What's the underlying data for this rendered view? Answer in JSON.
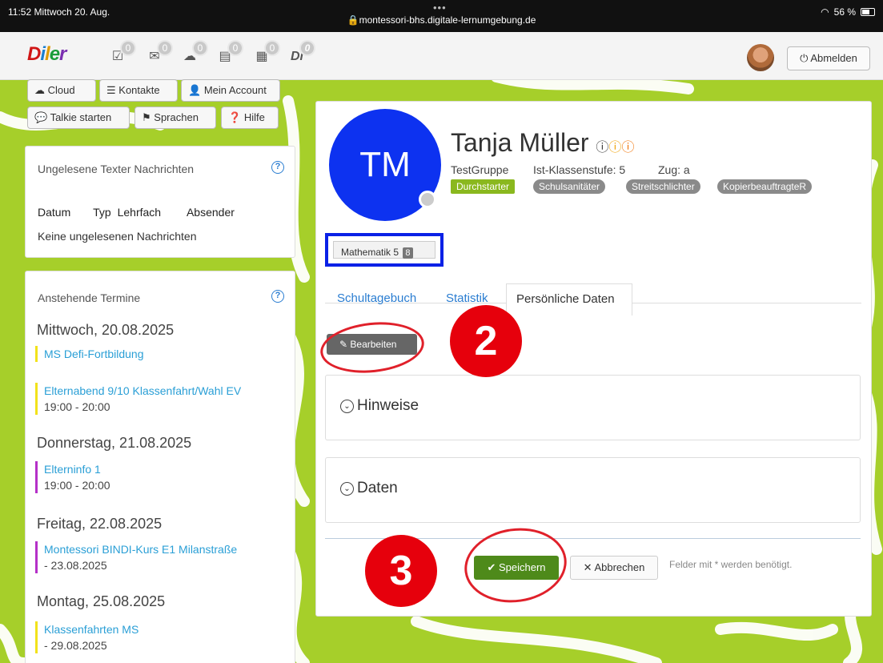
{
  "status_bar": {
    "time": "11:52",
    "date": "Mittwoch 20. Aug.",
    "dots": "•••",
    "url": "montessori-bhs.digitale-lernumgebung.de",
    "battery": "56 %"
  },
  "topbar": {
    "logo": {
      "d": "D",
      "i": "i",
      "l": "l",
      "e": "e",
      "r": "r"
    },
    "icons": [
      {
        "icon": "task-check-icon",
        "badge": "0"
      },
      {
        "icon": "mail-icon",
        "badge": "0"
      },
      {
        "icon": "cloud-icon",
        "badge": "0"
      },
      {
        "icon": "calendar-icon",
        "badge": "0"
      },
      {
        "icon": "building-icon",
        "badge": "0"
      },
      {
        "icon": "diler-app-icon",
        "badge": "0"
      }
    ],
    "logout_label": "Abmelden"
  },
  "sidebar": {
    "buttons": {
      "cloud": "Cloud",
      "kontakte": "Kontakte",
      "account": "Mein Account",
      "talkie": "Talkie starten",
      "sprachen": "Sprachen",
      "hilfe": "Hilfe"
    },
    "messages": {
      "title": "Ungelesene Texter Nachrichten",
      "headers": [
        "Datum",
        "Typ",
        "Lehrfach",
        "Absender"
      ],
      "empty": "Keine ungelesenen Nachrichten"
    },
    "appointments": {
      "title": "Anstehende Termine",
      "days": [
        {
          "day": "Mittwoch, 20.08.2025",
          "events": [
            {
              "title": "MS Defi-Fortbildung",
              "sub": "",
              "color": "#f2e21a"
            },
            {
              "title": "Elternabend 9/10 Klassenfahrt/Wahl EV",
              "sub": "19:00 - 20:00",
              "color": "#f2e21a"
            }
          ]
        },
        {
          "day": "Donnerstag, 21.08.2025",
          "events": [
            {
              "title": "Elterninfo 1",
              "sub": "19:00 - 20:00",
              "color": "#b530c8"
            }
          ]
        },
        {
          "day": "Freitag, 22.08.2025",
          "events": [
            {
              "title": "Montessori BINDI-Kurs E1 Milanstraße",
              "sub": "- 23.08.2025",
              "color": "#b530c8"
            }
          ]
        },
        {
          "day": "Montag, 25.08.2025",
          "events": [
            {
              "title": "Klassenfahrten MS",
              "sub": "- 29.08.2025",
              "color": "#f2e21a"
            }
          ]
        }
      ]
    }
  },
  "profile": {
    "initials": "TM",
    "name": "Tanja Müller",
    "group": "TestGruppe",
    "grade": "Ist-Klassenstufe: 5",
    "zug": "Zug: a",
    "tags": [
      "Durchstarter",
      "Schulsanitäter",
      "Streitschlichter",
      "KopierbeauftragteR"
    ],
    "subject": "Mathematik 5",
    "subject_count": "8"
  },
  "tabs": [
    "Schultagebuch",
    "Statistik",
    "Persönliche Daten"
  ],
  "edit_label": "Bearbeiten",
  "sections": [
    "Hinweise",
    "Daten"
  ],
  "form": {
    "save": "Speichern",
    "cancel": "Abbrechen",
    "required_note": "Felder mit * werden benötigt."
  },
  "annotations": {
    "step2": "2",
    "step3": "3"
  },
  "colors": {
    "accent_green": "#4e8a1a",
    "avatar_blue": "#0d32f0",
    "step_red": "#e6000c",
    "tag_green": "#8ab81e",
    "tag_gray": "#8a8a8a"
  }
}
